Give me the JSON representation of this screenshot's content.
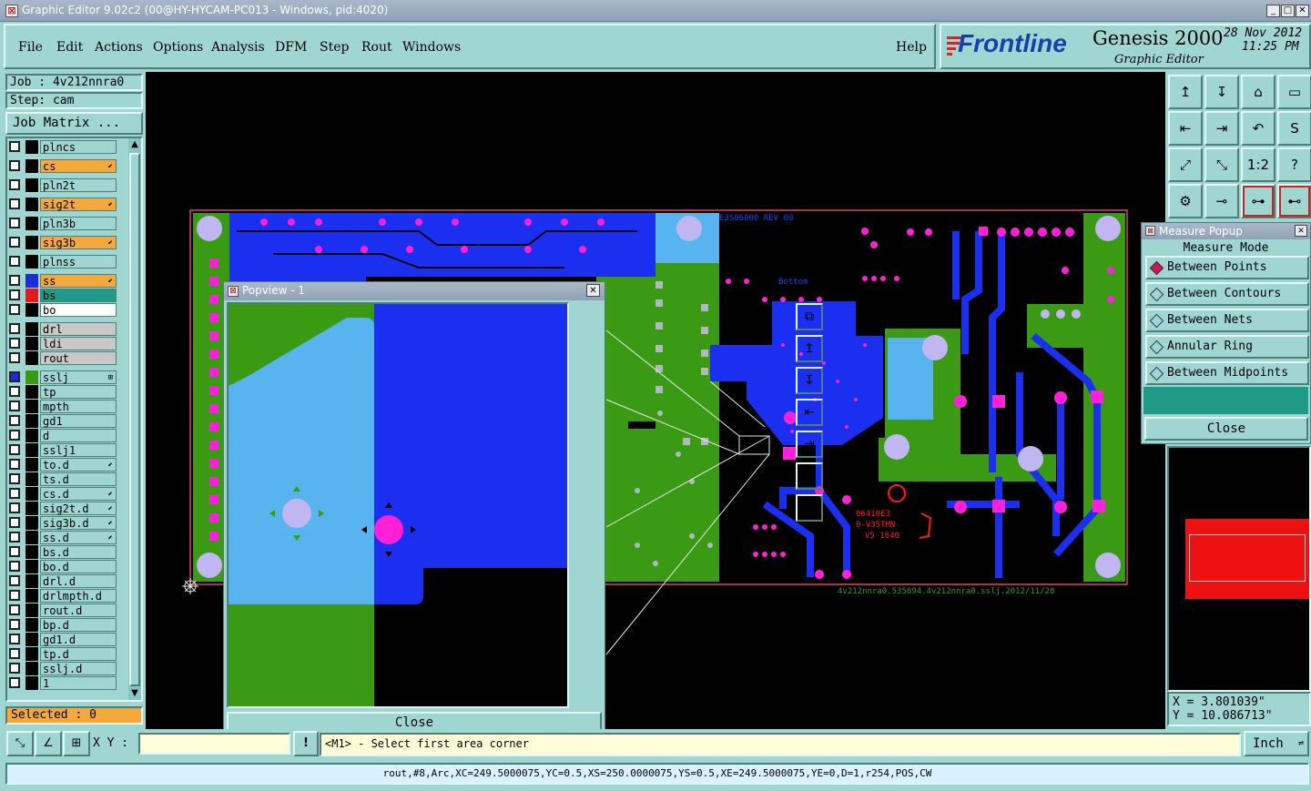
{
  "window": {
    "title": "Graphic Editor 9.02c2 (00@HY-HYCAM-PC013 - Windows, pid:4020)",
    "min": "_",
    "max": "□",
    "close": "✕"
  },
  "menu": {
    "items": [
      "File",
      "Edit",
      "Actions",
      "Options",
      "Analysis",
      "DFM",
      "Step",
      "Rout",
      "Windows"
    ],
    "help": "Help"
  },
  "brand": {
    "logo": "Frontline",
    "product": "Genesis 2000",
    "subtitle": "Graphic Editor",
    "date": "28 Nov 2012",
    "time": "11:25 PM"
  },
  "job": {
    "job_label": "Job  : 4v212nnra0",
    "step_label": "Step: cam",
    "matrix_button": "Job Matrix ..."
  },
  "layers": [
    {
      "name": "plncs",
      "swatch": "#000",
      "bg": "#a0d6d2",
      "arrow": ""
    },
    {
      "name": "cs",
      "swatch": "#000",
      "bg": "#f5a83c",
      "arrow": "⬋"
    },
    {
      "name": "pln2t",
      "swatch": "#000",
      "bg": "#a0d6d2",
      "arrow": ""
    },
    {
      "name": "sig2t",
      "swatch": "#000",
      "bg": "#f5a83c",
      "arrow": "⬋"
    },
    {
      "name": "pln3b",
      "swatch": "#000",
      "bg": "#a0d6d2",
      "arrow": ""
    },
    {
      "name": "sig3b",
      "swatch": "#000",
      "bg": "#f5a83c",
      "arrow": "⬋"
    },
    {
      "name": "plnss",
      "swatch": "#000",
      "bg": "#a0d6d2",
      "arrow": ""
    },
    {
      "name": "ss",
      "swatch": "#1a2dd8",
      "bg": "#f5a83c",
      "arrow": "⬋"
    },
    {
      "name": "bs",
      "swatch": "#e01b1b",
      "bg": "#1f9a86",
      "arrow": ""
    },
    {
      "name": "bo",
      "swatch": "#000",
      "bg": "#ffffff",
      "arrow": ""
    },
    {
      "name": "drl",
      "swatch": "#000",
      "bg": "#c8c8c8",
      "arrow": ""
    },
    {
      "name": "ldi",
      "swatch": "#000",
      "bg": "#c8c8c8",
      "arrow": ""
    },
    {
      "name": "rout",
      "swatch": "#000",
      "bg": "#c8c8c8",
      "arrow": ""
    },
    {
      "name": "sslj",
      "swatch": "#3b9a14",
      "bg": "#a0d6d2",
      "arrow": "⊞"
    },
    {
      "name": "tp",
      "swatch": "#000",
      "bg": "#a0d6d2",
      "arrow": ""
    },
    {
      "name": "mpth",
      "swatch": "#000",
      "bg": "#a0d6d2",
      "arrow": ""
    },
    {
      "name": "gd1",
      "swatch": "#000",
      "bg": "#a0d6d2",
      "arrow": ""
    },
    {
      "name": "d",
      "swatch": "#000",
      "bg": "#a0d6d2",
      "arrow": ""
    },
    {
      "name": "sslj1",
      "swatch": "#000",
      "bg": "#a0d6d2",
      "arrow": ""
    },
    {
      "name": "to.d",
      "swatch": "#000",
      "bg": "#a0d6d2",
      "arrow": "⬋"
    },
    {
      "name": "ts.d",
      "swatch": "#000",
      "bg": "#a0d6d2",
      "arrow": ""
    },
    {
      "name": "cs.d",
      "swatch": "#000",
      "bg": "#a0d6d2",
      "arrow": "⬋"
    },
    {
      "name": "sig2t.d",
      "swatch": "#000",
      "bg": "#a0d6d2",
      "arrow": "⬋"
    },
    {
      "name": "sig3b.d",
      "swatch": "#000",
      "bg": "#a0d6d2",
      "arrow": "⬋"
    },
    {
      "name": "ss.d",
      "swatch": "#000",
      "bg": "#a0d6d2",
      "arrow": "⬋"
    },
    {
      "name": "bs.d",
      "swatch": "#000",
      "bg": "#a0d6d2",
      "arrow": ""
    },
    {
      "name": "bo.d",
      "swatch": "#000",
      "bg": "#a0d6d2",
      "arrow": ""
    },
    {
      "name": "drl.d",
      "swatch": "#000",
      "bg": "#a0d6d2",
      "arrow": ""
    },
    {
      "name": "drlmpth.d",
      "swatch": "#000",
      "bg": "#a0d6d2",
      "arrow": ""
    },
    {
      "name": "rout.d",
      "swatch": "#000",
      "bg": "#a0d6d2",
      "arrow": ""
    },
    {
      "name": "bp.d",
      "swatch": "#000",
      "bg": "#a0d6d2",
      "arrow": ""
    },
    {
      "name": "gd1.d",
      "swatch": "#000",
      "bg": "#a0d6d2",
      "arrow": ""
    },
    {
      "name": "tp.d",
      "swatch": "#000",
      "bg": "#a0d6d2",
      "arrow": ""
    },
    {
      "name": "sslj.d",
      "swatch": "#000",
      "bg": "#a0d6d2",
      "arrow": ""
    },
    {
      "name": "1",
      "swatch": "#000",
      "bg": "#a0d6d2",
      "arrow": ""
    }
  ],
  "selected": "Selected : 0",
  "board": {
    "top_silk": "E3S06000 REV 00",
    "bottom_label": "4v212nnra0.535894.4v212nnra0.sslj.2012/11/28",
    "bottom_text": "Bottom"
  },
  "popview": {
    "title": "Popview - 1",
    "close": "Close"
  },
  "measure": {
    "title": "Measure Popup",
    "mode_label": "Measure Mode",
    "options": [
      "Between Points",
      "Between Contours",
      "Between Nets",
      "Annular Ring",
      "Between Midpoints"
    ],
    "selected_index": 0,
    "close": "Close"
  },
  "tools": [
    "↥",
    "↧",
    "⌂",
    "▭",
    "⇤",
    "⇥",
    "↶",
    "S",
    "⤢",
    "⤡",
    "1:2",
    "?",
    "⚙",
    "⊸",
    "⊶",
    "⊷"
  ],
  "coords": {
    "x": "X = 3.801039\"",
    "y": "Y = 10.086713\""
  },
  "bottom": {
    "xy_label": "X Y :",
    "xy_value": "",
    "prompt": "<M1> - Select first area corner",
    "units": "Inch",
    "status": "rout,#8,Arc,XC=249.5000075,YC=0.5,XS=250.0000075,YS=0.5,XE=249.5000075,YE=0,D=1,r254,POS,CW"
  }
}
